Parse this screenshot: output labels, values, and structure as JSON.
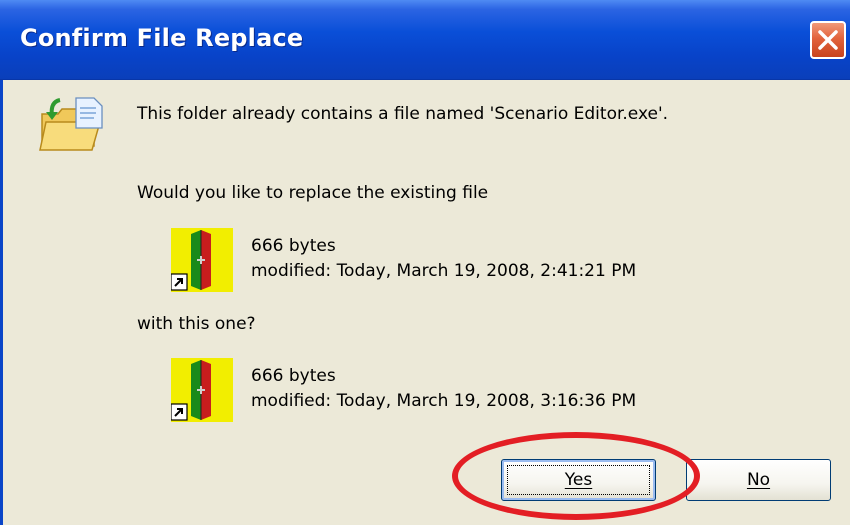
{
  "dialog": {
    "title": "Confirm File Replace",
    "message_exists": "This folder already contains a file named 'Scenario Editor.exe'.",
    "message_replace": "Would you like to replace the existing file",
    "message_with": "with this one?",
    "existing_file": {
      "size": "666 bytes",
      "modified": "modified: Today, March 19, 2008, 2:41:21 PM"
    },
    "new_file": {
      "size": "666 bytes",
      "modified": "modified: Today, March 19, 2008, 3:16:36 PM"
    },
    "buttons": {
      "yes_label": "Yes",
      "no_label": "No"
    }
  },
  "icons": {
    "close": "close-icon",
    "folder": "folder-replace-icon",
    "file": "scenario-editor-shortcut-icon"
  },
  "colors": {
    "title_bar": "#0a4fd8",
    "close_button": "#e2633c",
    "dialog_background": "#ece9d8",
    "highlight_ring": "#e31e24"
  }
}
